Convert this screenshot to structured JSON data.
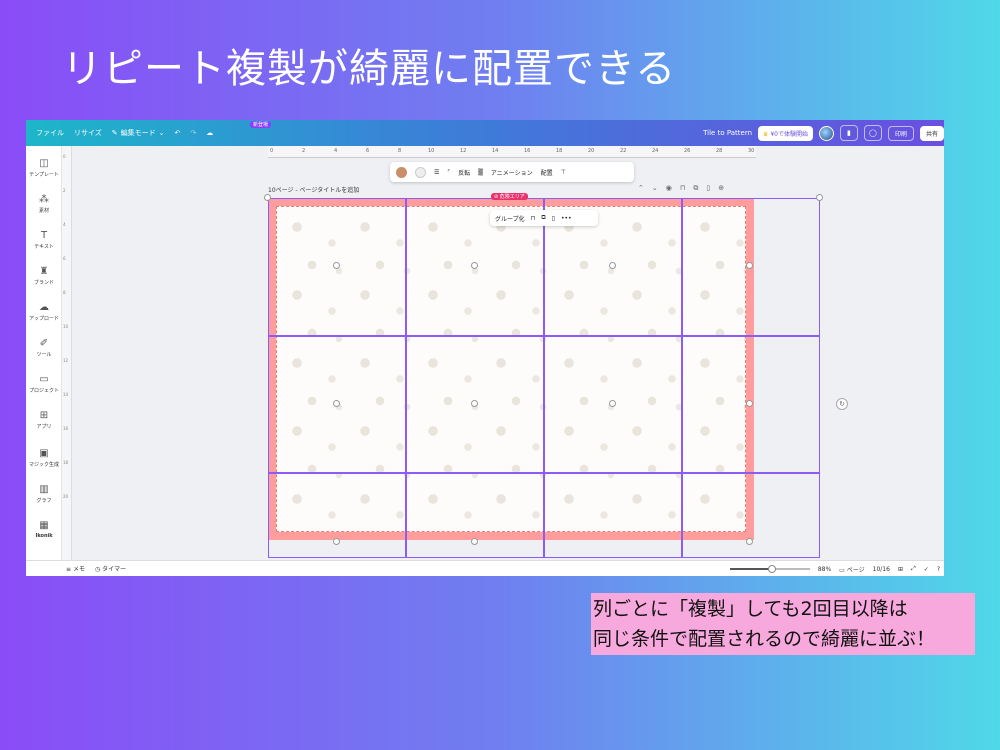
{
  "slide": {
    "title": "リピート複製が綺麗に配置できる",
    "caption_line1": "列ごとに「複製」しても2回目以降は",
    "caption_line2": "同じ条件で配置されるので綺麗に並ぶ！"
  },
  "app": {
    "menu": {
      "file": "ファイル",
      "resize": "リサイズ",
      "edit_mode": "編集モード",
      "new_badge": "新登場"
    },
    "header_right": {
      "design_title": "Tile to Pattern",
      "trial": "¥0で体験開始",
      "print": "印刷",
      "share": "共有"
    },
    "sidebar": [
      {
        "label": "テンプレート",
        "icon": "template-icon"
      },
      {
        "label": "素材",
        "icon": "elements-icon"
      },
      {
        "label": "テキスト",
        "icon": "text-icon"
      },
      {
        "label": "ブランド",
        "icon": "brand-icon"
      },
      {
        "label": "アップロード",
        "icon": "upload-icon"
      },
      {
        "label": "ツール",
        "icon": "draw-icon"
      },
      {
        "label": "プロジェクト",
        "icon": "folder-icon"
      },
      {
        "label": "アプリ",
        "icon": "apps-icon"
      },
      {
        "label": "マジック生成",
        "icon": "magic-icon"
      },
      {
        "label": "グラフ",
        "icon": "chart-icon"
      },
      {
        "label": "Ikonik",
        "icon": "ikonik-icon"
      }
    ],
    "hruler_labels": [
      "0",
      "2",
      "4",
      "6",
      "8",
      "10",
      "12",
      "14",
      "16",
      "18",
      "20",
      "22",
      "24",
      "26",
      "28",
      "30"
    ],
    "vruler_labels": [
      "0",
      "2",
      "4",
      "6",
      "8",
      "10",
      "12",
      "14",
      "16",
      "18",
      "20"
    ],
    "toolbar": {
      "swatch1": "#c98e6a",
      "swatch2": "#eeeeee",
      "flip": "反転",
      "animation": "アニメーション",
      "position": "配置"
    },
    "page": {
      "label": "10ページ - ページタイトルを追加"
    },
    "danger_tag": "危険エリア",
    "context_menu": {
      "group": "グループ化"
    },
    "bottom": {
      "notes": "メモ",
      "timer": "タイマー",
      "zoom": "88%",
      "pages": "ページ",
      "page_count": "10/16"
    },
    "colors": {
      "accent": "#8b5cf6",
      "canvas_bg": "#ff9c9c"
    }
  }
}
